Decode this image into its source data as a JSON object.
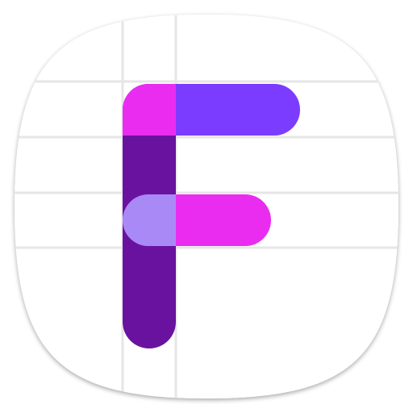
{
  "icon": {
    "name": "letter-f-app-icon",
    "colors": {
      "background": "#ffffff",
      "shadow": "#d9d9d9",
      "grid_line": "#e6e6e6",
      "stem": "#6a12a0",
      "top_bar": "#7c3cff",
      "top_cap": "#ea2cf0",
      "middle_bar": "#ea2cf0",
      "middle_cap": "#a989f5"
    }
  }
}
